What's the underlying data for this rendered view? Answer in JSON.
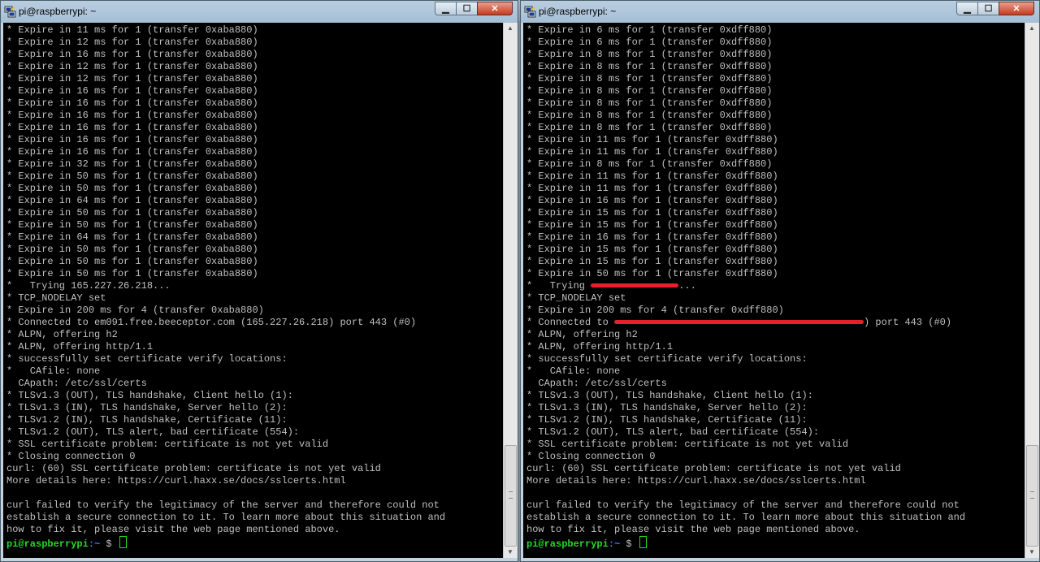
{
  "left": {
    "title": "pi@raspberrypi: ~",
    "lines": [
      "* Expire in 11 ms for 1 (transfer 0xaba880)",
      "* Expire in 12 ms for 1 (transfer 0xaba880)",
      "* Expire in 16 ms for 1 (transfer 0xaba880)",
      "* Expire in 12 ms for 1 (transfer 0xaba880)",
      "* Expire in 12 ms for 1 (transfer 0xaba880)",
      "* Expire in 16 ms for 1 (transfer 0xaba880)",
      "* Expire in 16 ms for 1 (transfer 0xaba880)",
      "* Expire in 16 ms for 1 (transfer 0xaba880)",
      "* Expire in 16 ms for 1 (transfer 0xaba880)",
      "* Expire in 16 ms for 1 (transfer 0xaba880)",
      "* Expire in 16 ms for 1 (transfer 0xaba880)",
      "* Expire in 32 ms for 1 (transfer 0xaba880)",
      "* Expire in 50 ms for 1 (transfer 0xaba880)",
      "* Expire in 50 ms for 1 (transfer 0xaba880)",
      "* Expire in 64 ms for 1 (transfer 0xaba880)",
      "* Expire in 50 ms for 1 (transfer 0xaba880)",
      "* Expire in 50 ms for 1 (transfer 0xaba880)",
      "* Expire in 64 ms for 1 (transfer 0xaba880)",
      "* Expire in 50 ms for 1 (transfer 0xaba880)",
      "* Expire in 50 ms for 1 (transfer 0xaba880)",
      "* Expire in 50 ms for 1 (transfer 0xaba880)",
      "*   Trying 165.227.26.218...",
      "* TCP_NODELAY set",
      "* Expire in 200 ms for 4 (transfer 0xaba880)",
      "* Connected to em091.free.beeceptor.com (165.227.26.218) port 443 (#0)",
      "* ALPN, offering h2",
      "* ALPN, offering http/1.1",
      "* successfully set certificate verify locations:",
      "*   CAfile: none",
      "  CApath: /etc/ssl/certs",
      "* TLSv1.3 (OUT), TLS handshake, Client hello (1):",
      "* TLSv1.3 (IN), TLS handshake, Server hello (2):",
      "* TLSv1.2 (IN), TLS handshake, Certificate (11):",
      "* TLSv1.2 (OUT), TLS alert, bad certificate (554):",
      "* SSL certificate problem: certificate is not yet valid",
      "* Closing connection 0",
      "curl: (60) SSL certificate problem: certificate is not yet valid",
      "More details here: https://curl.haxx.se/docs/sslcerts.html",
      "",
      "curl failed to verify the legitimacy of the server and therefore could not",
      "establish a secure connection to it. To learn more about this situation and",
      "how to fix it, please visit the web page mentioned above."
    ],
    "prompt": {
      "user": "pi@raspberrypi",
      "path": ":~",
      "symbol": " $ "
    }
  },
  "right": {
    "title": "pi@raspberrypi: ~",
    "lines_before": [
      "* Expire in 6 ms for 1 (transfer 0xdff880)",
      "* Expire in 6 ms for 1 (transfer 0xdff880)",
      "* Expire in 8 ms for 1 (transfer 0xdff880)",
      "* Expire in 8 ms for 1 (transfer 0xdff880)",
      "* Expire in 8 ms for 1 (transfer 0xdff880)",
      "* Expire in 8 ms for 1 (transfer 0xdff880)",
      "* Expire in 8 ms for 1 (transfer 0xdff880)",
      "* Expire in 8 ms for 1 (transfer 0xdff880)",
      "* Expire in 8 ms for 1 (transfer 0xdff880)",
      "* Expire in 11 ms for 1 (transfer 0xdff880)",
      "* Expire in 11 ms for 1 (transfer 0xdff880)",
      "* Expire in 8 ms for 1 (transfer 0xdff880)",
      "* Expire in 11 ms for 1 (transfer 0xdff880)",
      "* Expire in 11 ms for 1 (transfer 0xdff880)",
      "* Expire in 16 ms for 1 (transfer 0xdff880)",
      "* Expire in 15 ms for 1 (transfer 0xdff880)",
      "* Expire in 15 ms for 1 (transfer 0xdff880)",
      "* Expire in 16 ms for 1 (transfer 0xdff880)",
      "* Expire in 15 ms for 1 (transfer 0xdff880)",
      "* Expire in 15 ms for 1 (transfer 0xdff880)",
      "* Expire in 50 ms for 1 (transfer 0xdff880)"
    ],
    "trying": {
      "prefix": "*   Trying ",
      "suffix": "..."
    },
    "lines_mid": [
      "* TCP_NODELAY set",
      "* Expire in 200 ms for 4 (transfer 0xdff880)"
    ],
    "connected": {
      "prefix": "* Connected to ",
      "suffix": ") port 443 (#0)"
    },
    "lines_after": [
      "* ALPN, offering h2",
      "* ALPN, offering http/1.1",
      "* successfully set certificate verify locations:",
      "*   CAfile: none",
      "  CApath: /etc/ssl/certs",
      "* TLSv1.3 (OUT), TLS handshake, Client hello (1):",
      "* TLSv1.3 (IN), TLS handshake, Server hello (2):",
      "* TLSv1.2 (IN), TLS handshake, Certificate (11):",
      "* TLSv1.2 (OUT), TLS alert, bad certificate (554):",
      "* SSL certificate problem: certificate is not yet valid",
      "* Closing connection 0",
      "curl: (60) SSL certificate problem: certificate is not yet valid",
      "More details here: https://curl.haxx.se/docs/sslcerts.html",
      "",
      "curl failed to verify the legitimacy of the server and therefore could not",
      "establish a secure connection to it. To learn more about this situation and",
      "how to fix it, please visit the web page mentioned above."
    ],
    "prompt": {
      "user": "pi@raspberrypi",
      "path": ":~",
      "symbol": " $ "
    }
  },
  "window_controls": {
    "minimize": "▁",
    "maximize": "☐",
    "close": "✕"
  },
  "icons": {
    "app": "putty-icon",
    "redaction": "red-redaction-bar"
  },
  "colors": {
    "terminal_bg": "#000000",
    "terminal_fg": "#c0c0c0",
    "prompt_user": "#26d926",
    "prompt_path": "#4a7cff",
    "redaction": "#e8202a"
  }
}
